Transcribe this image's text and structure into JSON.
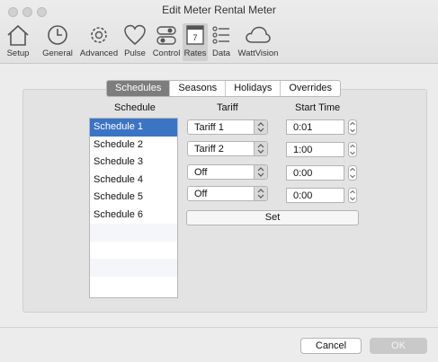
{
  "window": {
    "title": "Edit Meter Rental Meter"
  },
  "toolbar": {
    "items": [
      {
        "label": "Setup",
        "icon": "house-icon"
      },
      {
        "label": "General",
        "icon": "clock-icon"
      },
      {
        "label": "Advanced",
        "icon": "gear-icon"
      },
      {
        "label": "Pulse",
        "icon": "heart-icon"
      },
      {
        "label": "Control",
        "icon": "toggle-icon"
      },
      {
        "label": "Rates",
        "icon": "calendar-icon",
        "badge": "7",
        "active": true
      },
      {
        "label": "Data",
        "icon": "list-icon"
      },
      {
        "label": "WattVision",
        "icon": "cloud-icon"
      }
    ]
  },
  "tabs": [
    {
      "label": "Schedules",
      "selected": true
    },
    {
      "label": "Seasons"
    },
    {
      "label": "Holidays"
    },
    {
      "label": "Overrides"
    }
  ],
  "columns": {
    "schedule": "Schedule",
    "tariff": "Tariff",
    "start_time": "Start Time"
  },
  "schedules": [
    "Schedule 1",
    "Schedule 2",
    "Schedule 3",
    "Schedule 4",
    "Schedule 5",
    "Schedule 6"
  ],
  "selected_schedule": "Schedule 1",
  "entries": [
    {
      "tariff": "Tariff 1",
      "start": "0:01"
    },
    {
      "tariff": "Tariff 2",
      "start": "1:00"
    },
    {
      "tariff": "Off",
      "start": "0:00"
    },
    {
      "tariff": "Off",
      "start": "0:00"
    }
  ],
  "set_button": "Set",
  "footer": {
    "cancel": "Cancel",
    "ok": "OK"
  },
  "colors": {
    "selection": "#3c74c4",
    "active_tab": "#7d7d7d"
  }
}
